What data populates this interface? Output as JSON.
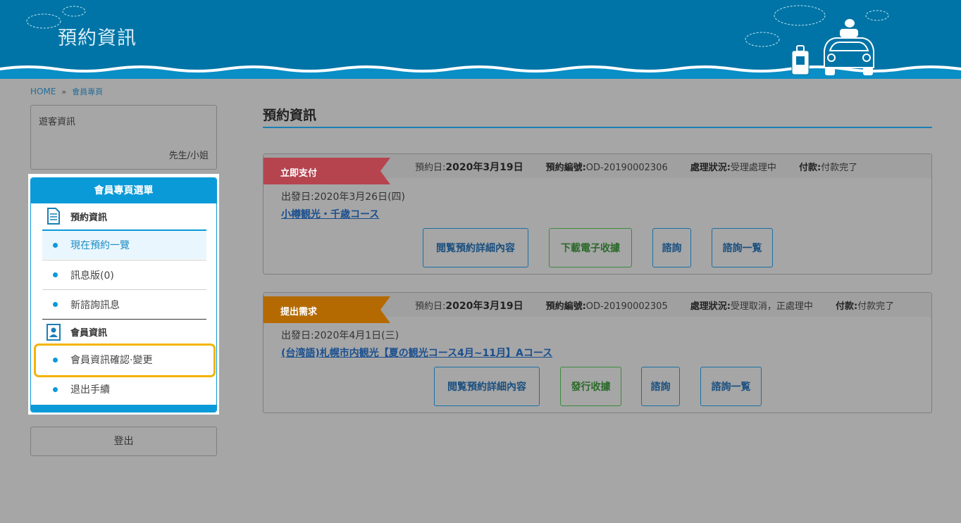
{
  "header": {
    "title": "預約資訊"
  },
  "breadcrumb": {
    "home": "HOME",
    "sep": "»",
    "current": "會員專頁"
  },
  "guest": {
    "label": "遊客資訊",
    "salutation": "先生/小姐"
  },
  "menu": {
    "title": "會員專頁選單",
    "section1": "預約資訊",
    "items1": [
      "現在預約一覽",
      "訊息版(0)",
      "新諮詢訊息"
    ],
    "section2": "會員資訊",
    "items2": [
      "會員資訊確認·變更",
      "退出手續"
    ]
  },
  "logout": "登出",
  "page": {
    "title": "預約資訊"
  },
  "reservations": [
    {
      "status_tag": "立即支付",
      "status_color": "#b5444f",
      "date_label": "預約日:",
      "date": "2020年3月19日",
      "no_label": "預約編號:",
      "no": "OD-20190002306",
      "proc_label": "處理狀況:",
      "proc": "受理處理中",
      "pay_label": "付款:",
      "pay": "付款完了",
      "depart": "出發日:2020年3月26日(四)",
      "tour": "小樽観光・千歳コース",
      "buttons": [
        "閲覧預約詳細內容",
        "下載電子收據",
        "諮詢",
        "諮詢一覧"
      ]
    },
    {
      "status_tag": "提出需求",
      "status_color": "#b46a00",
      "date_label": "預約日:",
      "date": "2020年3月19日",
      "no_label": "預約編號:",
      "no": "OD-20190002305",
      "proc_label": "處理狀況:",
      "proc": "受理取消，正處理中",
      "pay_label": "付款:",
      "pay": "付款完了",
      "depart": "出發日:2020年4月1日(三)",
      "tour": "(台湾語)札幌市内観光【夏の観光コース4月~11月】Aコース",
      "buttons": [
        "閲覧預約詳細內容",
        "發行收據",
        "諮詢",
        "諮詢一覧"
      ]
    }
  ]
}
